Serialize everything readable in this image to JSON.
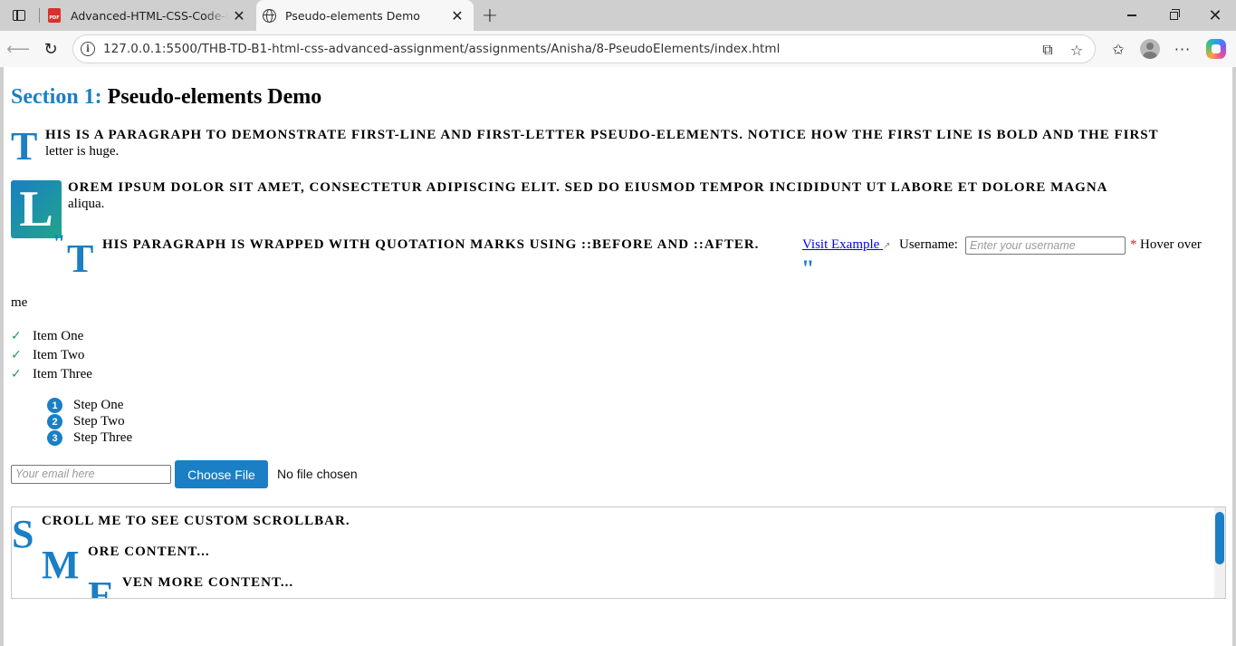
{
  "browser": {
    "tabs": [
      {
        "title": "Advanced-HTML-CSS-Code-Examples",
        "icon": "pdf-icon",
        "active": false
      },
      {
        "title": "Pseudo-elements Demo",
        "icon": "globe-icon",
        "active": true
      }
    ],
    "url": "127.0.0.1:5500/THB-TD-B1-html-css-advanced-assignment/assignments/Anisha/8-PseudoElements/index.html"
  },
  "page": {
    "heading_num": "Section 1:",
    "heading_text": "Pseudo-elements Demo",
    "p1_first_letter": "T",
    "p1_line1": "his is a paragraph to demonstrate first-line and first-letter pseudo-elements. Notice how the first line is bold and the first",
    "p1_line2": "letter is huge.",
    "p2_first_letter": "L",
    "p2_line1": "orem ipsum dolor sit amet, consectetur adipiscing elit. Sed do eiusmod tempor incididunt ut labore et dolore magna",
    "p2_line2": "aliqua.",
    "p3_open_quote": "\"",
    "p3_first_letter": "T",
    "p3_line1": "his paragraph is wrapped with quotation marks using ::before and ::after.",
    "p3_close_quote": "\"",
    "link_text": "Visit Example",
    "link_ext_icon": "↗",
    "username_label": "Username:",
    "username_placeholder": "Enter your username",
    "required_mark": "*",
    "hover_text": "Hover over",
    "hover_text_2": "me",
    "check_items": [
      "Item One",
      "Item Two",
      "Item Three"
    ],
    "check_icon": "✓",
    "steps": [
      {
        "num": "1",
        "label": "Step One"
      },
      {
        "num": "2",
        "label": "Step Two"
      },
      {
        "num": "3",
        "label": "Step Three"
      }
    ],
    "email_placeholder": "Your email here",
    "file_button": "Choose File",
    "file_status": "No file chosen",
    "scroll_lines": [
      {
        "letter": "S",
        "text": "croll me to see custom scrollbar."
      },
      {
        "letter": "M",
        "text": "ore content..."
      },
      {
        "letter": "E",
        "text": "ven more content..."
      }
    ]
  },
  "colors": {
    "accent": "#1a7fc4",
    "check": "#1e9e4a",
    "required": "#e02020"
  }
}
